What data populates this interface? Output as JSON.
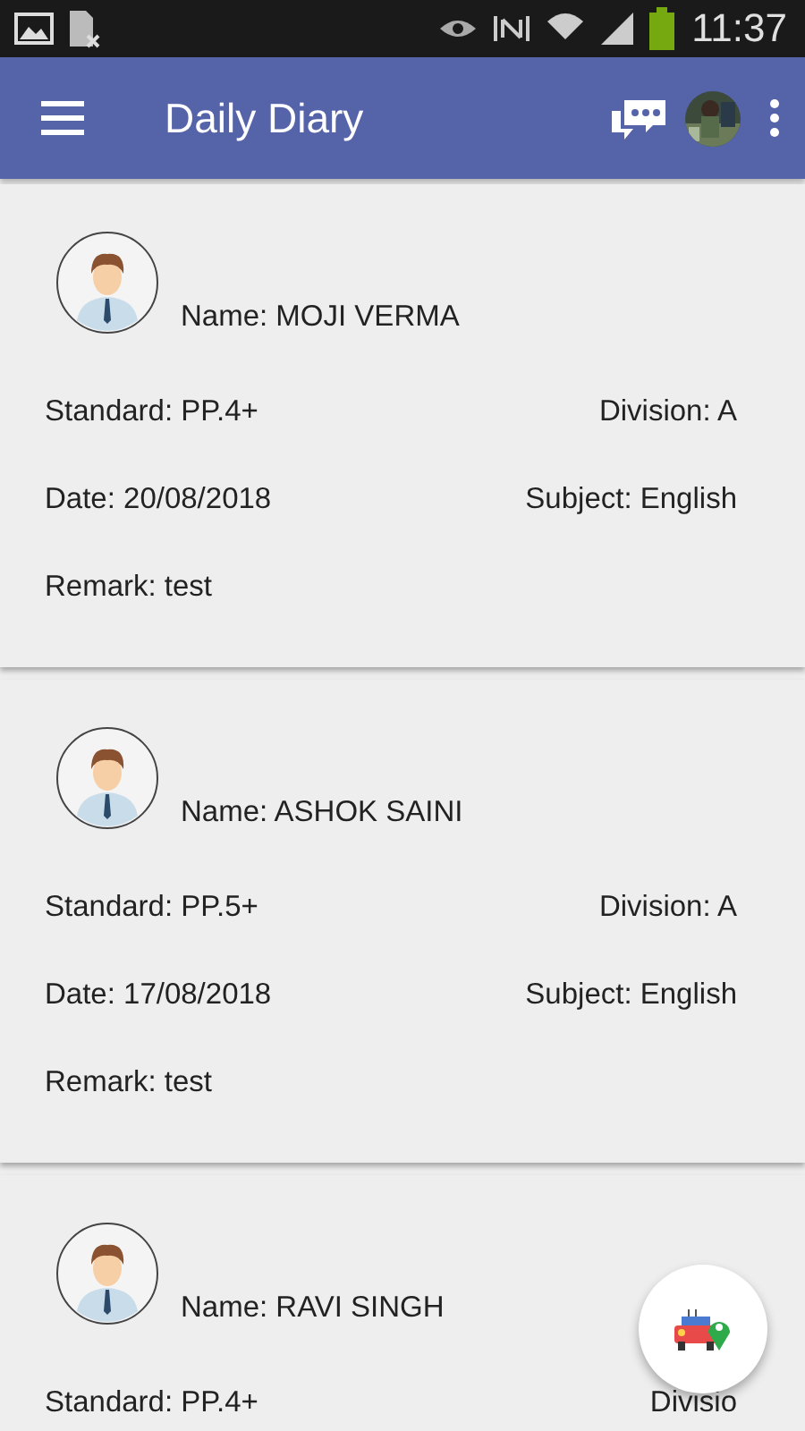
{
  "status_bar": {
    "time": "11:37"
  },
  "app_bar": {
    "title": "Daily Diary"
  },
  "entries": [
    {
      "name": "Name: MOJI VERMA",
      "standard": "Standard: PP.4+",
      "division": "Division: A",
      "date": "Date: 20/08/2018",
      "subject": "Subject: English",
      "remark": "Remark: test"
    },
    {
      "name": "Name: ASHOK SAINI",
      "standard": "Standard: PP.5+",
      "division": "Division: A",
      "date": "Date: 17/08/2018",
      "subject": "Subject: English",
      "remark": "Remark: test"
    },
    {
      "name": "Name: RAVI SINGH",
      "standard": "Standard: PP.4+",
      "division": "Divisio"
    }
  ]
}
